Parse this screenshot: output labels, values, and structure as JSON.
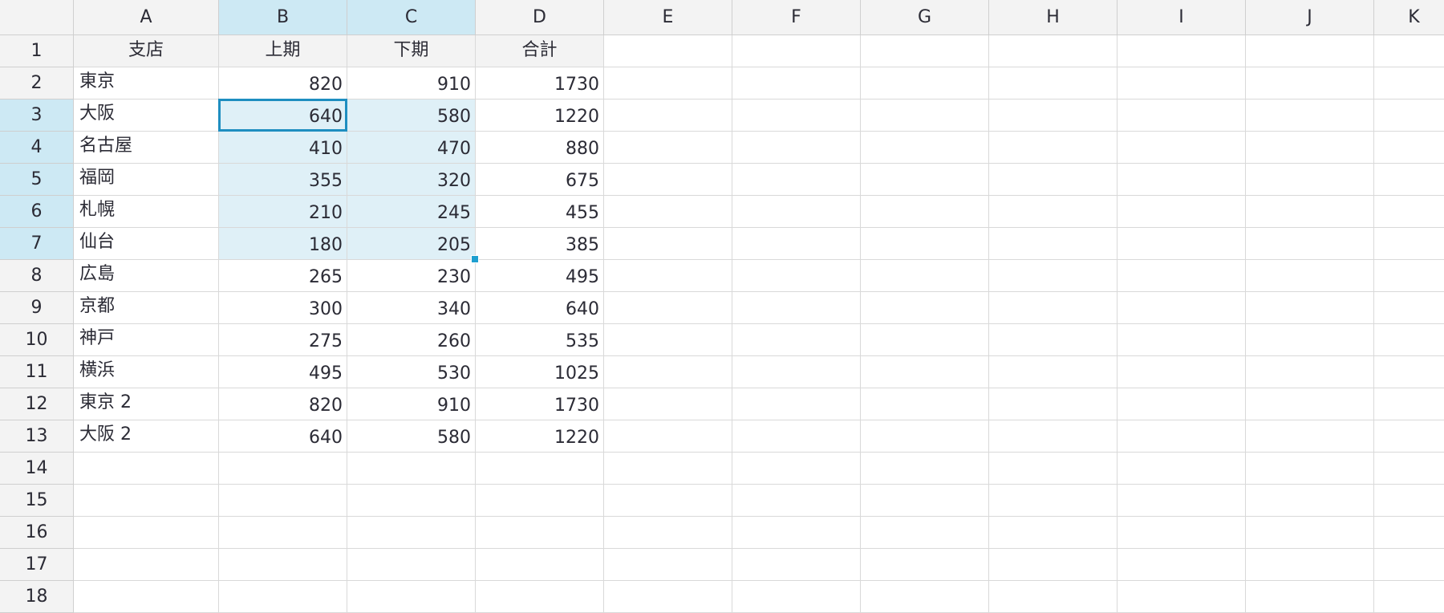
{
  "sheet": {
    "columns": [
      "A",
      "B",
      "C",
      "D",
      "E",
      "F",
      "G",
      "H",
      "I",
      "J",
      "K"
    ],
    "rows": [
      "1",
      "2",
      "3",
      "4",
      "5",
      "6",
      "7",
      "8",
      "9",
      "10",
      "11",
      "12",
      "13",
      "14",
      "15",
      "16",
      "17",
      "18"
    ],
    "active_cell": "B3",
    "selection_range": "B3:C7",
    "active_columns": [
      "B",
      "C"
    ],
    "active_rows": [
      "3",
      "4",
      "5",
      "6",
      "7"
    ],
    "colors": {
      "selection_border": "#1e8ec0",
      "selection_fill": "#dff0f7",
      "header_highlight": "#cde9f4",
      "fill_handle": "#1e9fd0"
    },
    "table_header": [
      "支店",
      "上期",
      "下期",
      "合計"
    ],
    "table_rows": [
      [
        "東京",
        "820",
        "910",
        "1730"
      ],
      [
        "大阪",
        "640",
        "580",
        "1220"
      ],
      [
        "名古屋",
        "410",
        "470",
        "880"
      ],
      [
        "福岡",
        "355",
        "320",
        "675"
      ],
      [
        "札幌",
        "210",
        "245",
        "455"
      ],
      [
        "仙台",
        "180",
        "205",
        "385"
      ],
      [
        "広島",
        "265",
        "230",
        "495"
      ],
      [
        "京都",
        "300",
        "340",
        "640"
      ],
      [
        "神戸",
        "275",
        "260",
        "535"
      ],
      [
        "横浜",
        "495",
        "530",
        "1025"
      ],
      [
        "東京 2",
        "820",
        "910",
        "1730"
      ],
      [
        "大阪 2",
        "640",
        "580",
        "1220"
      ]
    ]
  }
}
